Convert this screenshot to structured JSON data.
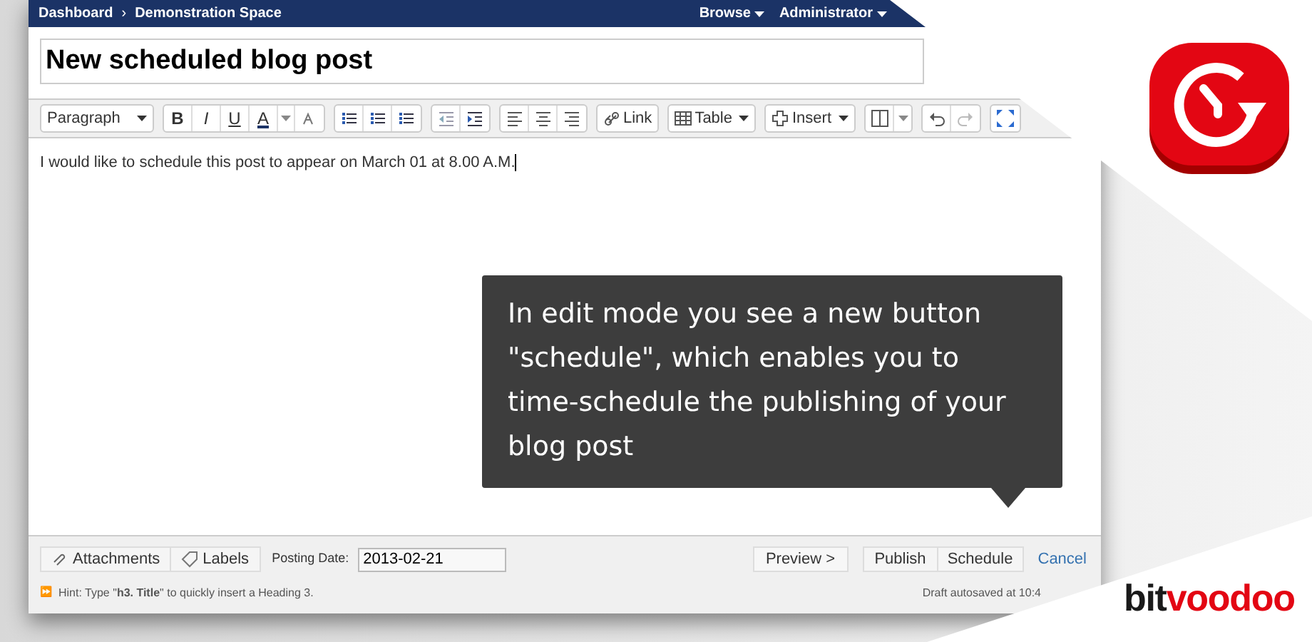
{
  "nav": {
    "breadcrumbs": [
      "Dashboard",
      "Demonstration Space"
    ],
    "separator": "›",
    "menus": [
      "Browse",
      "Administrator"
    ]
  },
  "title": {
    "value": "New scheduled blog post"
  },
  "toolbar": {
    "format": "Paragraph",
    "style_buttons": [
      "B",
      "I",
      "U",
      "A"
    ],
    "text_buttons": [
      {
        "label": "Link",
        "kind": "link"
      },
      {
        "label": "Table",
        "kind": "table"
      },
      {
        "label": "Insert",
        "kind": "insert"
      }
    ]
  },
  "body": {
    "text": "I would like to schedule this post to appear on March 01 at 8.00 A.M."
  },
  "callout": {
    "text": "In edit mode you see a new button \"schedule\", which enables you to time-schedule the publishing of your blog post"
  },
  "footer": {
    "attachments": "Attachments",
    "labels": "Labels",
    "posting_date_label": "Posting Date:",
    "posting_date": "2013-02-21",
    "preview": "Preview >",
    "publish": "Publish",
    "schedule": "Schedule",
    "cancel": "Cancel",
    "hint_arrow": "⏩",
    "hint": "Hint: Type \"**h3. Title**\" to quickly insert a Heading 3.",
    "autosave": "Draft autosaved at 10:4"
  },
  "brand": {
    "part_1": "bit",
    "part_2": "voodoo"
  }
}
